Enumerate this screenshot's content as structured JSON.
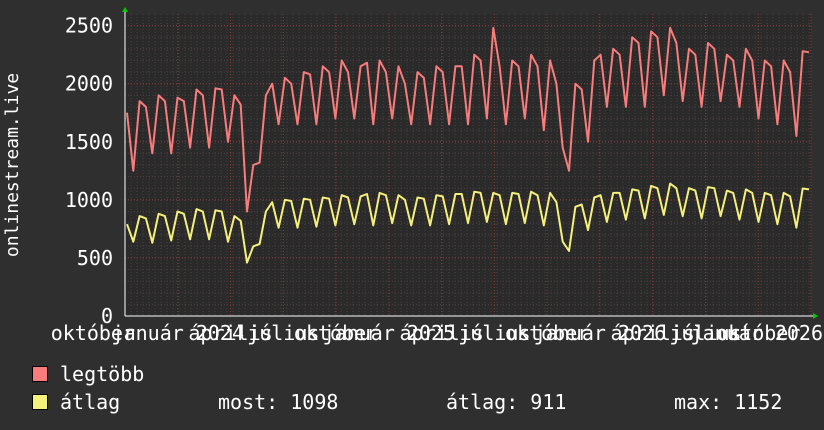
{
  "chart_data": {
    "type": "line",
    "ylabel": "onlinestream.live",
    "ylim": [
      0,
      2600
    ],
    "yticks": [
      0,
      500,
      1000,
      1500,
      2000,
      2500
    ],
    "grid": true,
    "xtick_labels": [
      "október",
      "január 2024",
      "április",
      "július",
      "október",
      "január 2025",
      "április",
      "július",
      "október",
      "január 2026",
      "április",
      "július",
      "október",
      "január 2026"
    ],
    "series": [
      {
        "name": "legtöbb",
        "color": "#f87c7c",
        "values": [
          1750,
          1250,
          1850,
          1800,
          1400,
          1900,
          1850,
          1400,
          1880,
          1850,
          1450,
          1950,
          1900,
          1450,
          1960,
          1950,
          1500,
          1900,
          1820,
          900,
          1300,
          1320,
          1900,
          2000,
          1650,
          2050,
          2000,
          1650,
          2100,
          2080,
          1650,
          2150,
          2100,
          1700,
          2200,
          2100,
          1700,
          2150,
          2180,
          1650,
          2200,
          2100,
          1700,
          2150,
          2000,
          1650,
          2100,
          2050,
          1650,
          2150,
          2100,
          1650,
          2150,
          2150,
          1650,
          2250,
          2200,
          1700,
          2480,
          2150,
          1650,
          2200,
          2150,
          1700,
          2250,
          2150,
          1600,
          2200,
          2000,
          1450,
          1250,
          2000,
          1950,
          1500,
          2200,
          2250,
          1800,
          2300,
          2250,
          1800,
          2400,
          2350,
          1800,
          2450,
          2400,
          1900,
          2480,
          2350,
          1850,
          2300,
          2250,
          1800,
          2350,
          2300,
          1850,
          2250,
          2200,
          1800,
          2300,
          2200,
          1700,
          2200,
          2150,
          1650,
          2200,
          2100,
          1550,
          2280,
          2270
        ]
      },
      {
        "name": "átlag",
        "color": "#f4f07c",
        "values": [
          790,
          640,
          860,
          840,
          630,
          880,
          860,
          650,
          900,
          880,
          660,
          920,
          900,
          660,
          910,
          900,
          640,
          860,
          820,
          460,
          600,
          620,
          900,
          980,
          760,
          1000,
          990,
          760,
          1010,
          1000,
          770,
          1020,
          1010,
          780,
          1040,
          1020,
          790,
          1030,
          1050,
          780,
          1060,
          1040,
          800,
          1040,
          1000,
          780,
          1020,
          1010,
          780,
          1040,
          1030,
          790,
          1050,
          1050,
          800,
          1070,
          1060,
          810,
          1060,
          1040,
          790,
          1060,
          1050,
          800,
          1070,
          1040,
          780,
          1060,
          980,
          640,
          560,
          940,
          960,
          740,
          1020,
          1040,
          810,
          1060,
          1060,
          830,
          1090,
          1080,
          840,
          1120,
          1100,
          870,
          1140,
          1100,
          860,
          1100,
          1080,
          840,
          1110,
          1100,
          860,
          1080,
          1060,
          830,
          1090,
          1060,
          810,
          1060,
          1040,
          790,
          1060,
          1030,
          760,
          1098,
          1090
        ]
      }
    ]
  },
  "legend": {
    "max_label": "legtöbb",
    "avg_label": "átlag",
    "max_color": "#f87c7c",
    "avg_color": "#f4f07c"
  },
  "stats": {
    "now": "most: 1098",
    "avg": "átlag: 911",
    "max": "max: 1152"
  }
}
